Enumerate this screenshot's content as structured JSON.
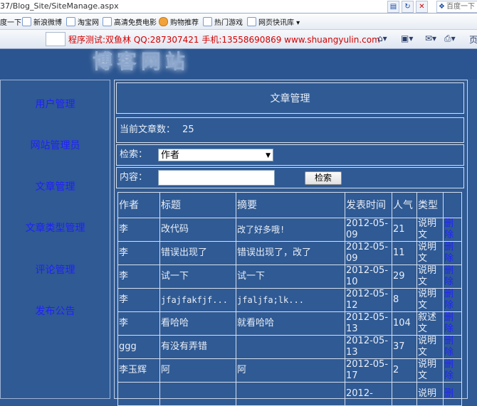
{
  "browser": {
    "url": "37/Blog_Site/SiteManage.aspx",
    "search_placeholder": "百度一下",
    "favorites": [
      {
        "label": "度一下",
        "icon": "none"
      },
      {
        "label": "新浪微博",
        "icon": "ie-icon"
      },
      {
        "label": "淘宝网",
        "icon": "ie-icon"
      },
      {
        "label": "高清免费电影",
        "icon": "ie-icon"
      },
      {
        "label": "购物推荐",
        "icon": "orange-icon"
      },
      {
        "label": "热门游戏",
        "icon": "ie-icon"
      },
      {
        "label": "网页快讯库 ▾",
        "icon": "ie-icon"
      }
    ],
    "info_text": "程序测试:双鱼林 QQ:287307421 手机:13558690869 www.shuangyulin.com",
    "right_label": "页"
  },
  "header": {
    "logo_text": "博客网站"
  },
  "sidebar": {
    "items": [
      {
        "label": "用户管理"
      },
      {
        "label": "网站管理员"
      },
      {
        "label": "文章管理"
      },
      {
        "label": "文章类型管理"
      },
      {
        "label": "评论管理"
      },
      {
        "label": "发布公告"
      }
    ]
  },
  "main": {
    "title": "文章管理",
    "count_label": "当前文章数：",
    "count_value": "25",
    "search_label": "检索：",
    "search_field_value": "作者",
    "content_label": "内容：",
    "content_value": "",
    "search_button": "检索"
  },
  "table": {
    "headers": [
      "作者",
      "标题",
      "摘要",
      "发表时间",
      "人气",
      "类型",
      ""
    ],
    "rows": [
      {
        "author": "李",
        "title": "改代码",
        "abstract": "改了好多哦!",
        "date": "2012-05-09",
        "views": "21",
        "type": "说明文",
        "action": "删除"
      },
      {
        "author": "李",
        "title": "错误出现了",
        "abstract": "错误出现了，改了",
        "date": "2012-05-09",
        "views": "11",
        "type": "说明文",
        "action": "删除"
      },
      {
        "author": "李",
        "title": "试一下",
        "abstract": "试一下",
        "date": "2012-05-10",
        "views": "29",
        "type": "说明文",
        "action": "删除"
      },
      {
        "author": "李",
        "title": "jfajfakfjf...",
        "abstract": "jfaljfa;lk...",
        "date": "2012-05-12",
        "views": "8",
        "type": "说明文",
        "action": "删除"
      },
      {
        "author": "李",
        "title": "看哈哈",
        "abstract": "就看哈哈",
        "date": "2012-05-13",
        "views": "104",
        "type": "叙述文",
        "action": "删除"
      },
      {
        "author": "ggg",
        "title": "有没有弄错",
        "abstract": "",
        "date": "2012-05-13",
        "views": "37",
        "type": "说明文",
        "action": "删除"
      },
      {
        "author": "李玉辉",
        "title": "阿",
        "abstract": "阿",
        "date": "2012-05-17",
        "views": "2",
        "type": "说明文",
        "action": "删除"
      },
      {
        "author": "",
        "title": "",
        "abstract": "",
        "date": "2012-",
        "views": "",
        "type": "说明",
        "action": "删"
      }
    ]
  }
}
